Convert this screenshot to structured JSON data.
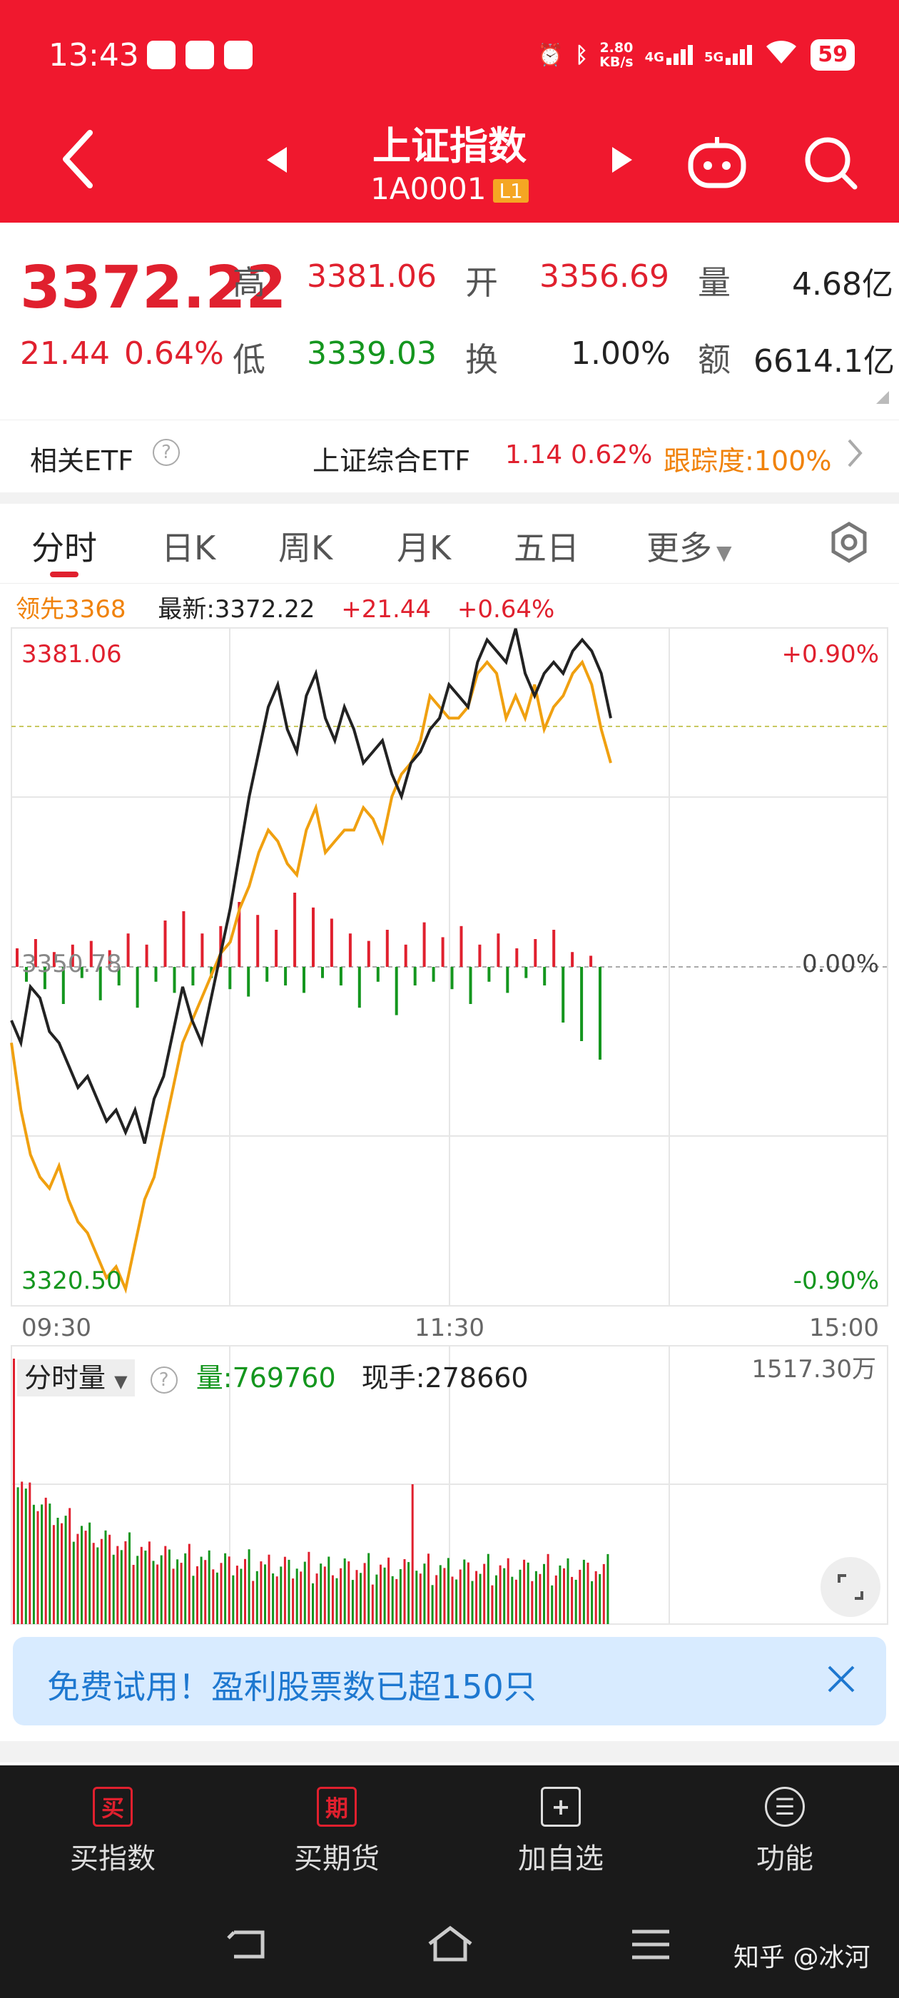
{
  "status_bar": {
    "time": "13:43",
    "net_speed_value": "2.80",
    "net_speed_unit": "KB/s",
    "net1": "4G",
    "net2": "5G",
    "battery": "59"
  },
  "header": {
    "title": "上证指数",
    "code": "1A0001",
    "badge": "L1"
  },
  "quote": {
    "price": "3372.22",
    "change": "21.44",
    "change_pct": "0.64%",
    "high_label": "高",
    "high": "3381.06",
    "open_label": "开",
    "open": "3356.69",
    "volume_label": "量",
    "volume": "4.68亿",
    "low_label": "低",
    "low": "3339.03",
    "turnover_label": "换",
    "turnover": "1.00%",
    "amount_label": "额",
    "amount": "6614.1亿"
  },
  "etf": {
    "label": "相关ETF",
    "name": "上证综合ETF",
    "price": "1.14",
    "pct": "0.62%",
    "tracking": "跟踪度:100%"
  },
  "tabs": [
    "分时",
    "日K",
    "周K",
    "月K",
    "五日",
    "更多"
  ],
  "legend": {
    "lead": "领先3368",
    "latest": "最新:3372.22",
    "chg": "+21.44",
    "pct": "+0.64%"
  },
  "chart_labels": {
    "top_left": "3381.06",
    "top_right": "+0.90%",
    "mid_left": "3350.78",
    "mid_right": "0.00%",
    "bottom_left": "3320.50",
    "bottom_right": "-0.90%",
    "t_start": "09:30",
    "t_mid": "11:30",
    "t_end": "15:00"
  },
  "chart_data": {
    "type": "line",
    "ylim": [
      3320.5,
      3381.06
    ],
    "prev_close": 3350.78,
    "x_range": [
      "09:30",
      "15:00"
    ],
    "series": [
      {
        "color": "#222222",
        "values": [
          3346,
          3344,
          3349,
          3348,
          3345,
          3344,
          3342,
          3340,
          3341,
          3339,
          3337,
          3338,
          3336,
          3338,
          3335,
          3339,
          3341,
          3345,
          3349,
          3346,
          3344,
          3348,
          3352,
          3356,
          3361,
          3366,
          3370,
          3374,
          3376,
          3372,
          3370,
          3375,
          3377,
          3373,
          3371,
          3374,
          3372,
          3369,
          3370,
          3371,
          3368,
          3366,
          3369,
          3370,
          3372,
          3373,
          3376,
          3375,
          3374,
          3378,
          3380,
          3379,
          3378,
          3381,
          3377,
          3375,
          3377,
          3378,
          3377,
          3379,
          3380,
          3379,
          3377,
          3373
        ]
      },
      {
        "color": "#f0a010",
        "values": [
          3344,
          3338,
          3334,
          3332,
          3331,
          3333,
          3330,
          3328,
          3327,
          3325,
          3323,
          3324,
          3322,
          3326,
          3330,
          3332,
          3336,
          3340,
          3344,
          3346,
          3348,
          3350,
          3352,
          3353,
          3356,
          3358,
          3361,
          3363,
          3362,
          3360,
          3359,
          3363,
          3365,
          3361,
          3362,
          3363,
          3363,
          3365,
          3364,
          3362,
          3366,
          3368,
          3369,
          3371,
          3375,
          3374,
          3373,
          3373,
          3374,
          3377,
          3378,
          3377,
          3373,
          3375,
          3373,
          3376,
          3372,
          3374,
          3375,
          3377,
          3378,
          3376,
          3372,
          3369
        ]
      }
    ],
    "bars_pct_of_max": [
      10,
      -8,
      15,
      -12,
      8,
      -20,
      12,
      -6,
      14,
      -18,
      9,
      -10,
      18,
      -22,
      12,
      -8,
      25,
      -14,
      30,
      -10,
      18,
      -6,
      22,
      -12,
      35,
      -16,
      28,
      -8,
      20,
      -10,
      40,
      -14,
      32,
      -6,
      26,
      -10,
      18,
      -22,
      14,
      -8,
      20,
      -26,
      12,
      -10,
      24,
      -8,
      16,
      -12,
      22,
      -20,
      12,
      -8,
      18,
      -14,
      10,
      -6,
      15,
      -10,
      20,
      -30,
      8,
      -40,
      6,
      -50
    ]
  },
  "vol_panel": {
    "label": "分时量",
    "vol_label": "量:769760",
    "hand_label": "现手:278660",
    "max_label": "1517.30万"
  },
  "banner": {
    "text": "免费试用！盈利股票数已超150只"
  },
  "bottom": {
    "b1_icon": "买",
    "b1": "买指数",
    "b2_icon": "期",
    "b2": "买期货",
    "b3": "加自选",
    "b4": "功能"
  },
  "watermark": "知乎 @冰河"
}
